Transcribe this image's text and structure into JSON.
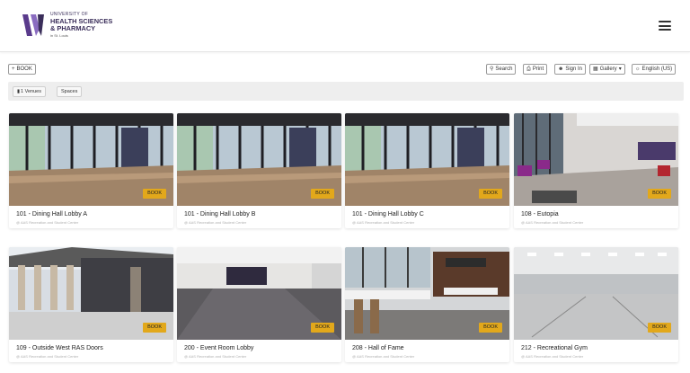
{
  "header": {
    "logo": {
      "line1": "UNIVERSITY OF",
      "line2": "HEALTH SCIENCES",
      "line3": "& PHARMACY",
      "line4": "in St. Louis"
    },
    "menu_icon": "hamburger-menu-icon"
  },
  "toolbar": {
    "book_label": "BOOK",
    "search_label": "Search",
    "print_label": "Print",
    "signin_label": "Sign In",
    "gallery_label": "Gallery",
    "language_label": "English (US)"
  },
  "filters": {
    "venues_label": "1  Venues",
    "spaces_label": "Spaces"
  },
  "cards": [
    {
      "title": "101 - Dining Hall Lobby A",
      "subtitle": "@ AAS Recreation and Student Center",
      "badge": "BOOK"
    },
    {
      "title": "101 - Dining Hall Lobby B",
      "subtitle": "@ AAS Recreation and Student Center",
      "badge": "BOOK"
    },
    {
      "title": "101 - Dining Hall Lobby C",
      "subtitle": "@ AAS Recreation and Student Center",
      "badge": "BOOK"
    },
    {
      "title": "108 - Eutopia",
      "subtitle": "@ AAS Recreation and Student Center",
      "badge": "BOOK"
    },
    {
      "title": "109 - Outside West RAS Doors",
      "subtitle": "@ AAS Recreation and Student Center",
      "badge": "BOOK"
    },
    {
      "title": "200 - Event Room Lobby",
      "subtitle": "@ AAS Recreation and Student Center",
      "badge": "BOOK"
    },
    {
      "title": "208 - Hall of Fame",
      "subtitle": "@ AAS Recreation and Student Center",
      "badge": "BOOK"
    },
    {
      "title": "212 - Recreational Gym",
      "subtitle": "@ AAS Recreation and Student Center",
      "badge": "BOOK"
    }
  ],
  "colors": {
    "brand_purple": "#3a2e5a",
    "badge_gold": "#e2a81b",
    "filter_bg": "#eeeeee"
  }
}
